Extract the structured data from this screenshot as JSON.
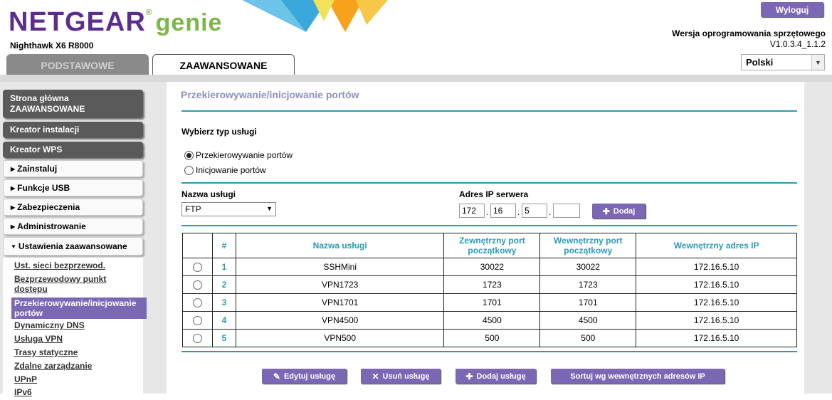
{
  "header": {
    "logo_brand": "NETGEAR",
    "logo_product": "genie",
    "model": "Nighthawk X6 R8000",
    "logout_label": "Wyloguj",
    "firmware_label": "Wersja oprogramowania sprzętowego",
    "firmware_version": "V1.0.3.4_1.1.2",
    "language": "Polski",
    "tabs": [
      {
        "label": "PODSTAWOWE",
        "active": false
      },
      {
        "label": "ZAAWANSOWANE",
        "active": true
      }
    ]
  },
  "sidebar": {
    "main_items": [
      "Strona główna",
      "ZAAWANSOWANE",
      "Kreator instalacji",
      "Kreator WPS"
    ],
    "sections": [
      "Zainstaluj",
      "Funkcje USB",
      "Zabezpieczenia",
      "Administrowanie",
      "Ustawienia zaawansowane"
    ],
    "sub_items": [
      "Ust. sieci bezprzewod.",
      "Bezprzewodowy punkt",
      "dostępu",
      "Przekierowywanie/inicjowanie",
      "portów",
      "Dynamiczny DNS",
      "Usługa VPN",
      "Trasy statyczne",
      "Zdalne zarządzanie",
      "UPnP",
      "IPv6"
    ]
  },
  "page": {
    "title": "Przekierowywanie/inicjowanie portów",
    "service_type_label": "Wybierz typ usługi",
    "radio_forwarding": "Przekierowywanie portów",
    "radio_triggering": "Inicjowanie portów",
    "service_name_label": "Nazwa usługi",
    "service_name_value": "FTP",
    "server_ip_label": "Adres IP serwera",
    "ip_octets": [
      "172",
      "16",
      "5",
      ""
    ],
    "add_label": "Dodaj"
  },
  "table": {
    "headers": [
      "#",
      "Nazwa usługi",
      "Zewnętrzny port początkowy",
      "Wewnętrzny port początkowy",
      "Wewnętrzny adres IP"
    ],
    "rows": [
      {
        "num": "1",
        "name": "SSHMini",
        "ext": "30022",
        "int": "30022",
        "ip": "172.16.5.10"
      },
      {
        "num": "2",
        "name": "VPN1723",
        "ext": "1723",
        "int": "1723",
        "ip": "172.16.5.10"
      },
      {
        "num": "3",
        "name": "VPN1701",
        "ext": "1701",
        "int": "1701",
        "ip": "172.16.5.10"
      },
      {
        "num": "4",
        "name": "VPN4500",
        "ext": "4500",
        "int": "4500",
        "ip": "172.16.5.10"
      },
      {
        "num": "5",
        "name": "VPN500",
        "ext": "500",
        "int": "500",
        "ip": "172.16.5.10"
      }
    ]
  },
  "actions": {
    "edit": "Edytuj usługę",
    "delete": "Usuń usługę",
    "add": "Dodaj usługę",
    "sort": "Sortuj wg wewnętrznych adresów IP"
  }
}
